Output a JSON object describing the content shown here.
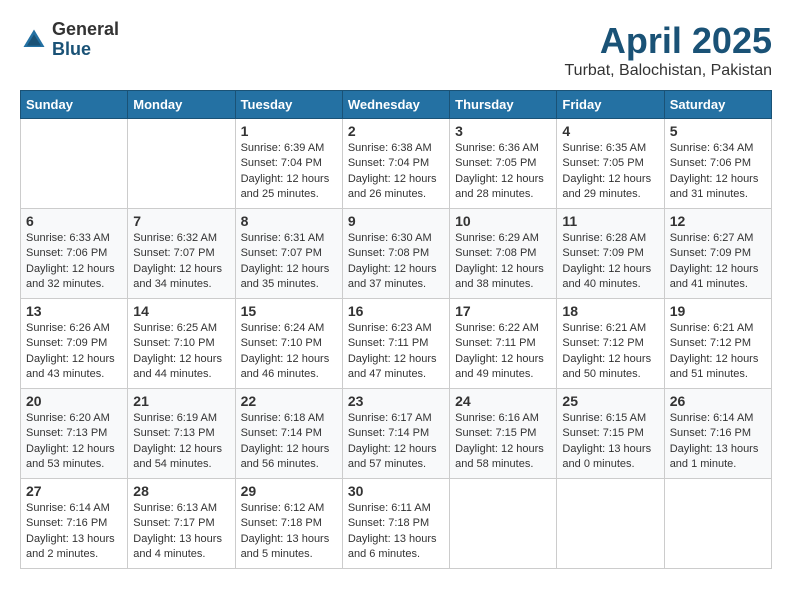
{
  "header": {
    "logo_general": "General",
    "logo_blue": "Blue",
    "title": "April 2025",
    "subtitle": "Turbat, Balochistan, Pakistan"
  },
  "weekdays": [
    "Sunday",
    "Monday",
    "Tuesday",
    "Wednesday",
    "Thursday",
    "Friday",
    "Saturday"
  ],
  "weeks": [
    [
      {
        "day": "",
        "empty": true
      },
      {
        "day": "",
        "empty": true
      },
      {
        "day": "1",
        "sunrise": "Sunrise: 6:39 AM",
        "sunset": "Sunset: 7:04 PM",
        "daylight": "Daylight: 12 hours and 25 minutes."
      },
      {
        "day": "2",
        "sunrise": "Sunrise: 6:38 AM",
        "sunset": "Sunset: 7:04 PM",
        "daylight": "Daylight: 12 hours and 26 minutes."
      },
      {
        "day": "3",
        "sunrise": "Sunrise: 6:36 AM",
        "sunset": "Sunset: 7:05 PM",
        "daylight": "Daylight: 12 hours and 28 minutes."
      },
      {
        "day": "4",
        "sunrise": "Sunrise: 6:35 AM",
        "sunset": "Sunset: 7:05 PM",
        "daylight": "Daylight: 12 hours and 29 minutes."
      },
      {
        "day": "5",
        "sunrise": "Sunrise: 6:34 AM",
        "sunset": "Sunset: 7:06 PM",
        "daylight": "Daylight: 12 hours and 31 minutes."
      }
    ],
    [
      {
        "day": "6",
        "sunrise": "Sunrise: 6:33 AM",
        "sunset": "Sunset: 7:06 PM",
        "daylight": "Daylight: 12 hours and 32 minutes."
      },
      {
        "day": "7",
        "sunrise": "Sunrise: 6:32 AM",
        "sunset": "Sunset: 7:07 PM",
        "daylight": "Daylight: 12 hours and 34 minutes."
      },
      {
        "day": "8",
        "sunrise": "Sunrise: 6:31 AM",
        "sunset": "Sunset: 7:07 PM",
        "daylight": "Daylight: 12 hours and 35 minutes."
      },
      {
        "day": "9",
        "sunrise": "Sunrise: 6:30 AM",
        "sunset": "Sunset: 7:08 PM",
        "daylight": "Daylight: 12 hours and 37 minutes."
      },
      {
        "day": "10",
        "sunrise": "Sunrise: 6:29 AM",
        "sunset": "Sunset: 7:08 PM",
        "daylight": "Daylight: 12 hours and 38 minutes."
      },
      {
        "day": "11",
        "sunrise": "Sunrise: 6:28 AM",
        "sunset": "Sunset: 7:09 PM",
        "daylight": "Daylight: 12 hours and 40 minutes."
      },
      {
        "day": "12",
        "sunrise": "Sunrise: 6:27 AM",
        "sunset": "Sunset: 7:09 PM",
        "daylight": "Daylight: 12 hours and 41 minutes."
      }
    ],
    [
      {
        "day": "13",
        "sunrise": "Sunrise: 6:26 AM",
        "sunset": "Sunset: 7:09 PM",
        "daylight": "Daylight: 12 hours and 43 minutes."
      },
      {
        "day": "14",
        "sunrise": "Sunrise: 6:25 AM",
        "sunset": "Sunset: 7:10 PM",
        "daylight": "Daylight: 12 hours and 44 minutes."
      },
      {
        "day": "15",
        "sunrise": "Sunrise: 6:24 AM",
        "sunset": "Sunset: 7:10 PM",
        "daylight": "Daylight: 12 hours and 46 minutes."
      },
      {
        "day": "16",
        "sunrise": "Sunrise: 6:23 AM",
        "sunset": "Sunset: 7:11 PM",
        "daylight": "Daylight: 12 hours and 47 minutes."
      },
      {
        "day": "17",
        "sunrise": "Sunrise: 6:22 AM",
        "sunset": "Sunset: 7:11 PM",
        "daylight": "Daylight: 12 hours and 49 minutes."
      },
      {
        "day": "18",
        "sunrise": "Sunrise: 6:21 AM",
        "sunset": "Sunset: 7:12 PM",
        "daylight": "Daylight: 12 hours and 50 minutes."
      },
      {
        "day": "19",
        "sunrise": "Sunrise: 6:21 AM",
        "sunset": "Sunset: 7:12 PM",
        "daylight": "Daylight: 12 hours and 51 minutes."
      }
    ],
    [
      {
        "day": "20",
        "sunrise": "Sunrise: 6:20 AM",
        "sunset": "Sunset: 7:13 PM",
        "daylight": "Daylight: 12 hours and 53 minutes."
      },
      {
        "day": "21",
        "sunrise": "Sunrise: 6:19 AM",
        "sunset": "Sunset: 7:13 PM",
        "daylight": "Daylight: 12 hours and 54 minutes."
      },
      {
        "day": "22",
        "sunrise": "Sunrise: 6:18 AM",
        "sunset": "Sunset: 7:14 PM",
        "daylight": "Daylight: 12 hours and 56 minutes."
      },
      {
        "day": "23",
        "sunrise": "Sunrise: 6:17 AM",
        "sunset": "Sunset: 7:14 PM",
        "daylight": "Daylight: 12 hours and 57 minutes."
      },
      {
        "day": "24",
        "sunrise": "Sunrise: 6:16 AM",
        "sunset": "Sunset: 7:15 PM",
        "daylight": "Daylight: 12 hours and 58 minutes."
      },
      {
        "day": "25",
        "sunrise": "Sunrise: 6:15 AM",
        "sunset": "Sunset: 7:15 PM",
        "daylight": "Daylight: 13 hours and 0 minutes."
      },
      {
        "day": "26",
        "sunrise": "Sunrise: 6:14 AM",
        "sunset": "Sunset: 7:16 PM",
        "daylight": "Daylight: 13 hours and 1 minute."
      }
    ],
    [
      {
        "day": "27",
        "sunrise": "Sunrise: 6:14 AM",
        "sunset": "Sunset: 7:16 PM",
        "daylight": "Daylight: 13 hours and 2 minutes."
      },
      {
        "day": "28",
        "sunrise": "Sunrise: 6:13 AM",
        "sunset": "Sunset: 7:17 PM",
        "daylight": "Daylight: 13 hours and 4 minutes."
      },
      {
        "day": "29",
        "sunrise": "Sunrise: 6:12 AM",
        "sunset": "Sunset: 7:18 PM",
        "daylight": "Daylight: 13 hours and 5 minutes."
      },
      {
        "day": "30",
        "sunrise": "Sunrise: 6:11 AM",
        "sunset": "Sunset: 7:18 PM",
        "daylight": "Daylight: 13 hours and 6 minutes."
      },
      {
        "day": "",
        "empty": true
      },
      {
        "day": "",
        "empty": true
      },
      {
        "day": "",
        "empty": true
      }
    ]
  ]
}
